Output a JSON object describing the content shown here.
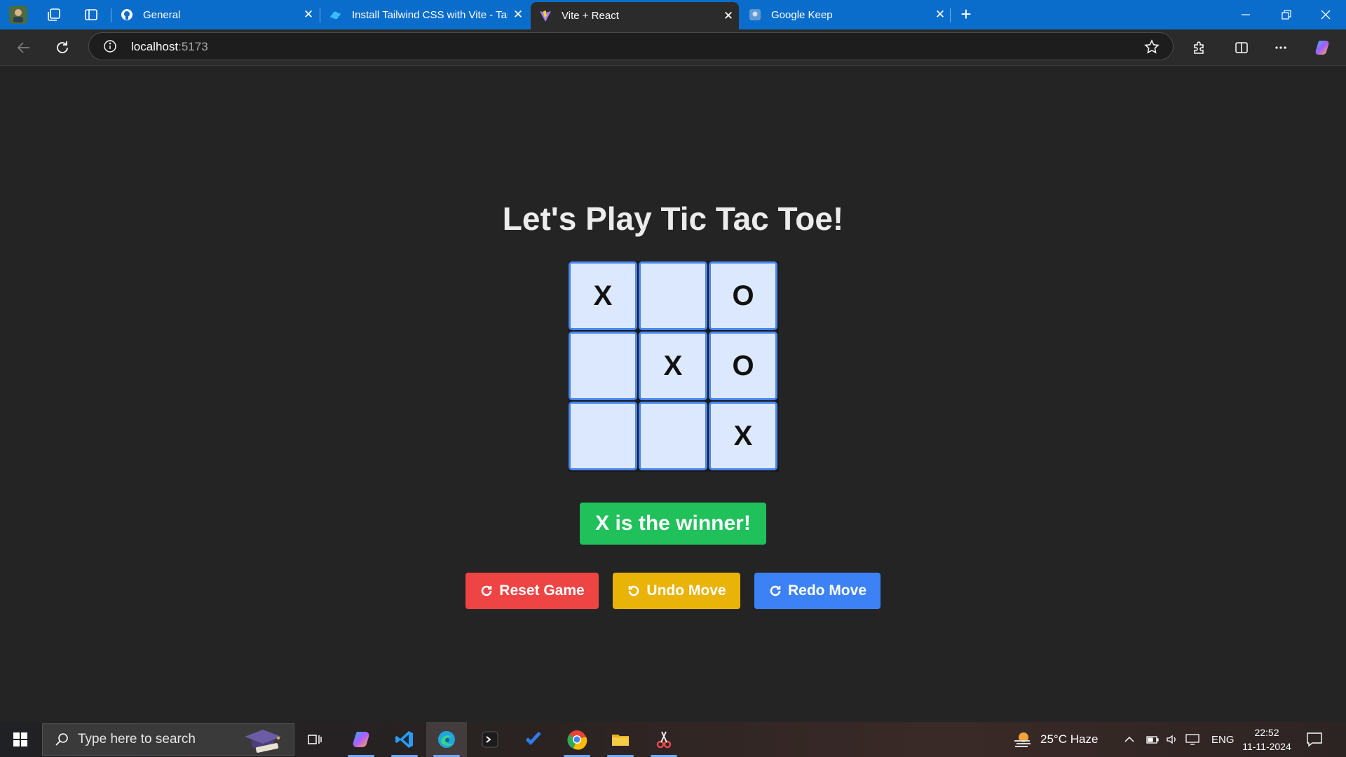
{
  "browser": {
    "tabs": [
      {
        "title": "General"
      },
      {
        "title": "Install Tailwind CSS with Vite - Tailwind CSS"
      },
      {
        "title": "Vite + React"
      },
      {
        "title": "Google Keep"
      }
    ],
    "close_glyph": "✕",
    "new_tab_glyph": "+",
    "address": {
      "host": "localhost",
      "port": ":5173"
    }
  },
  "game": {
    "title": "Let's Play Tic Tac Toe!",
    "board": [
      "X",
      "",
      "O",
      "",
      "X",
      "O",
      "",
      "",
      "X"
    ],
    "status": "X is the winner!",
    "buttons": {
      "reset": "Reset Game",
      "undo": "Undo Move",
      "redo": "Redo Move"
    },
    "colors": {
      "reset": "#ee4444",
      "undo": "#e9b308",
      "redo": "#3c82f6",
      "status": "#20c05b",
      "cell": "#dbe8fd",
      "cell_border": "#4a86ee"
    }
  },
  "taskbar": {
    "search_placeholder": "Type here to search",
    "weather": "25°C  Haze",
    "language": "ENG",
    "time": "22:52",
    "date": "11-11-2024"
  }
}
